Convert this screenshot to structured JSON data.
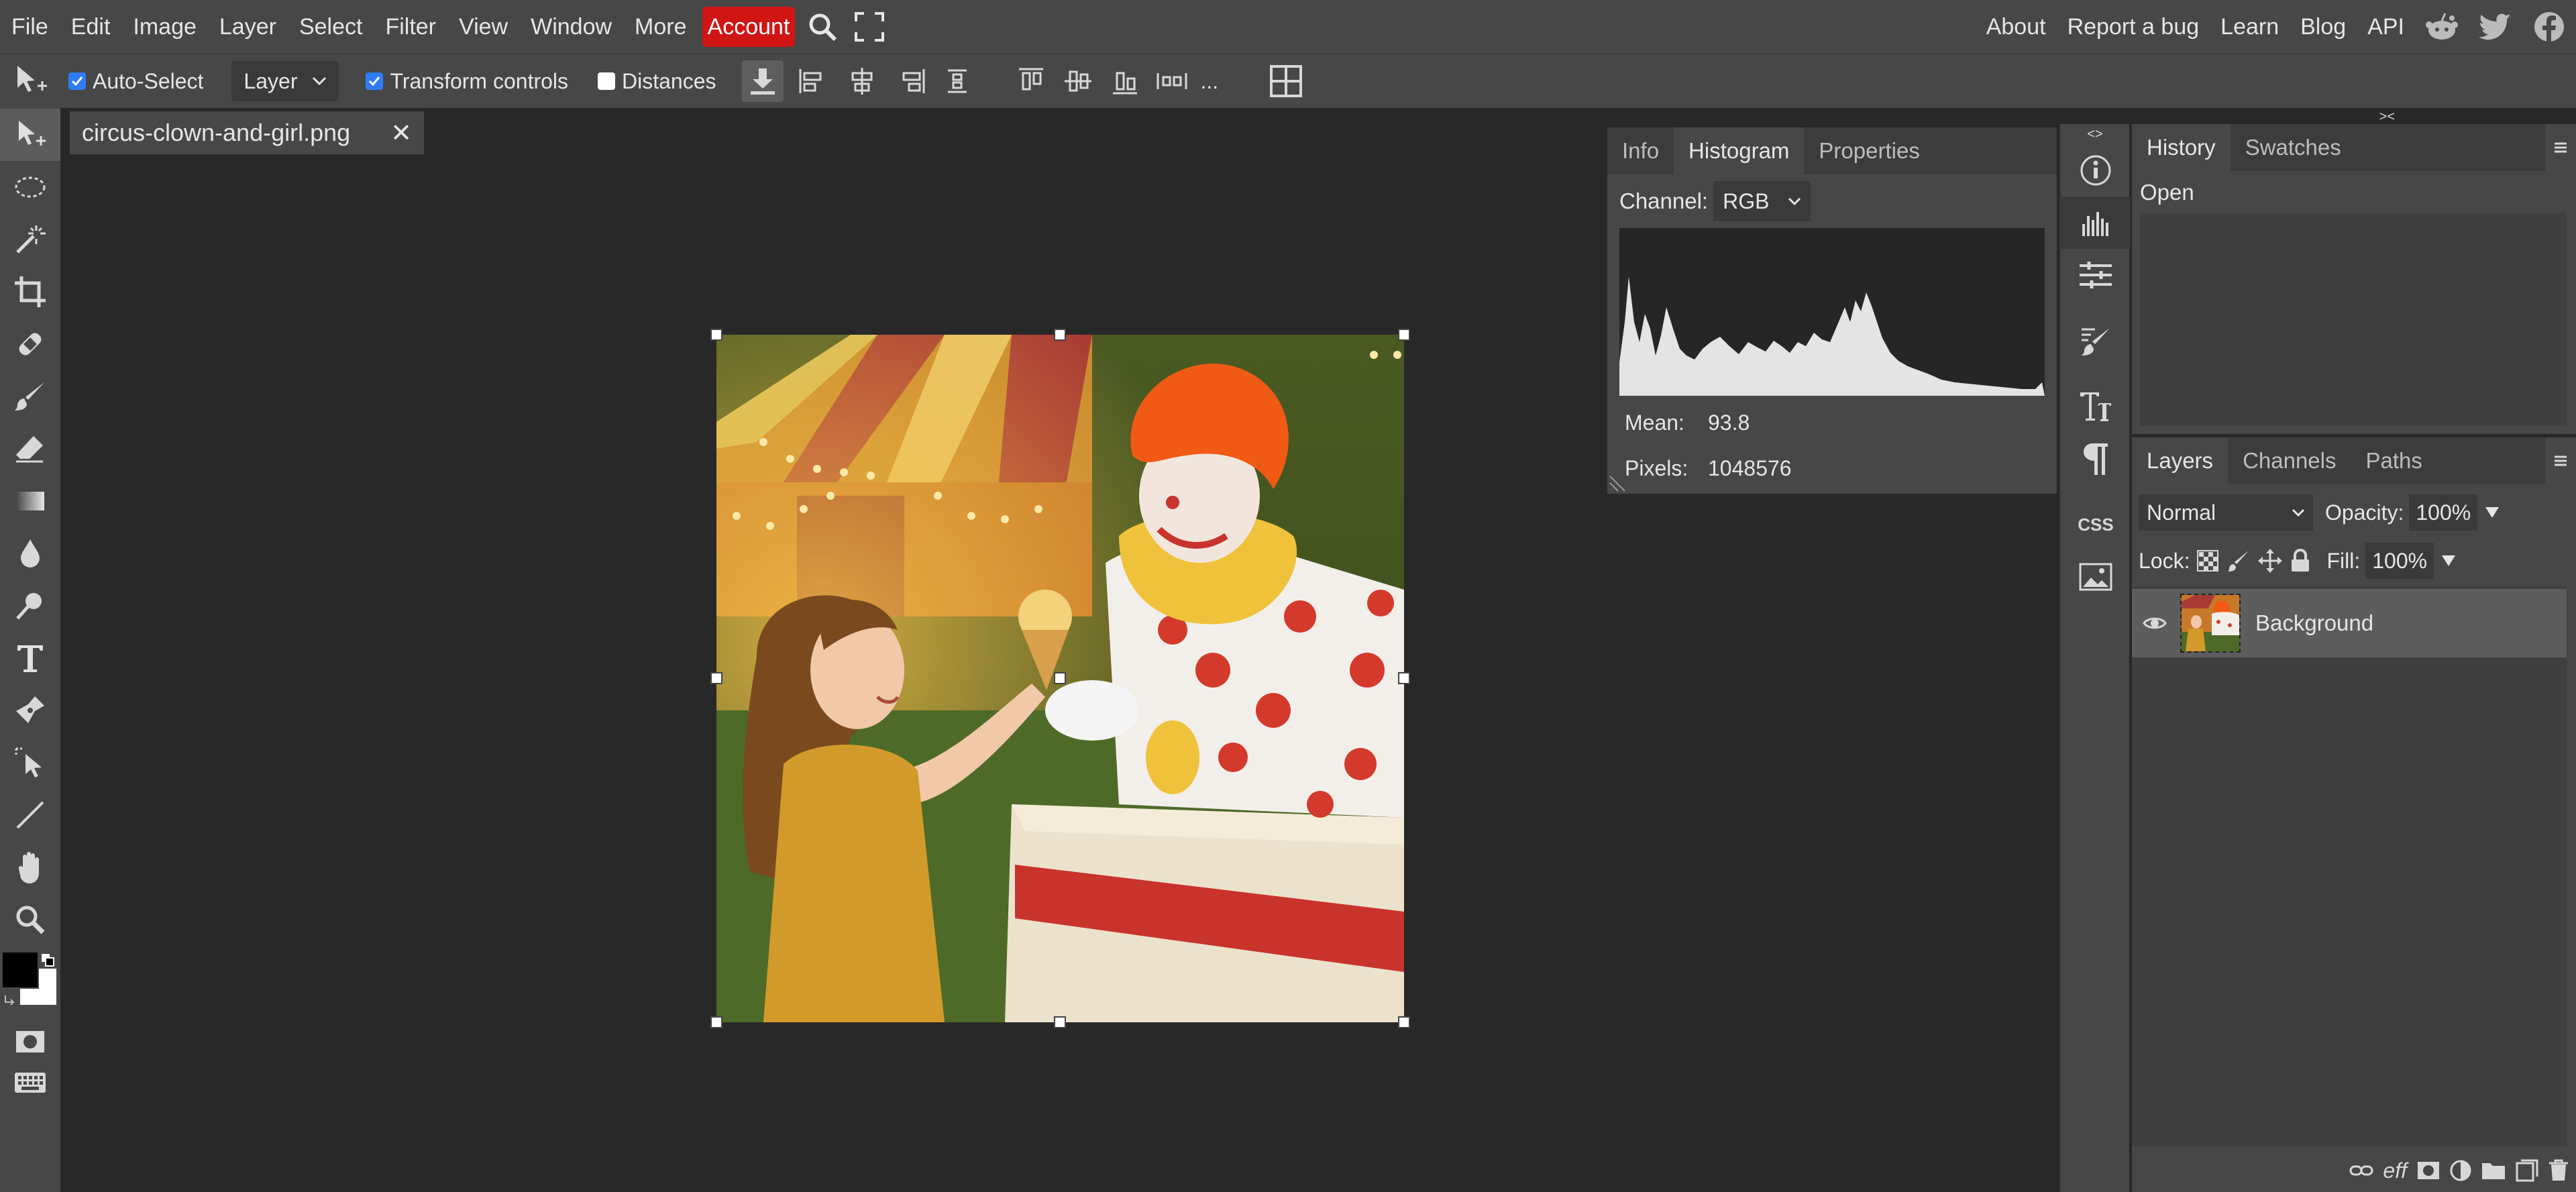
{
  "menubar": {
    "items": [
      "File",
      "Edit",
      "Image",
      "Layer",
      "Select",
      "Filter",
      "View",
      "Window",
      "More"
    ],
    "account": "Account",
    "right_links": [
      "About",
      "Report a bug",
      "Learn",
      "Blog",
      "API"
    ],
    "social_icons": [
      "reddit-icon",
      "twitter-icon",
      "facebook-icon"
    ],
    "account_color": "#d01515"
  },
  "optionsbar": {
    "auto_select_label": "Auto-Select",
    "auto_select_checked": true,
    "layer_select": "Layer",
    "transform_controls_label": "Transform controls",
    "transform_controls_checked": true,
    "distances_label": "Distances",
    "distances_checked": false,
    "more": "..."
  },
  "document": {
    "tab_name": "circus-clown-and-girl.png",
    "close": "✕"
  },
  "histogram_panel": {
    "tabs": [
      "Info",
      "Histogram",
      "Properties"
    ],
    "active_tab": "Histogram",
    "channel_label": "Channel:",
    "channel_value": "RGB",
    "mean_label": "Mean:",
    "mean_value": "93.8",
    "pixels_label": "Pixels:",
    "pixels_value": "1048576"
  },
  "history_panel": {
    "tabs": [
      "History",
      "Swatches"
    ],
    "active_tab": "History",
    "items": [
      "Open"
    ],
    "collapse_left": "<>",
    "collapse_right": "><"
  },
  "layers_panel": {
    "tabs": [
      "Layers",
      "Channels",
      "Paths"
    ],
    "active_tab": "Layers",
    "blend_mode": "Normal",
    "opacity_label": "Opacity:",
    "opacity_value": "100%",
    "lock_label": "Lock:",
    "fill_label": "Fill:",
    "fill_value": "100%",
    "layers": [
      {
        "name": "Background",
        "visible": true
      }
    ],
    "bottom_icons": [
      "link-icon",
      "effects-icon",
      "mask-icon",
      "adjustment-icon",
      "folder-icon",
      "new-layer-icon",
      "delete-icon"
    ],
    "effects_text": "eff"
  },
  "iconstrip": {
    "icons": [
      "info-icon",
      "histogram-icon",
      "adjustments-icon",
      "brush-settings-icon",
      "character-icon",
      "paragraph-icon",
      "css-icon",
      "image-icon"
    ],
    "css_text": "CSS"
  },
  "toolbar": {
    "tools": [
      "move-tool-icon",
      "marquee-tool-icon",
      "magic-wand-icon",
      "crop-tool-icon",
      "healing-tool-icon",
      "brush-tool-icon",
      "eraser-tool-icon",
      "gradient-tool-icon",
      "blur-tool-icon",
      "dodge-tool-icon",
      "type-tool-icon",
      "pen-tool-icon",
      "path-select-icon",
      "line-tool-icon",
      "hand-tool-icon",
      "zoom-tool-icon"
    ],
    "foreground_color": "#000000",
    "background_color": "#ffffff"
  }
}
